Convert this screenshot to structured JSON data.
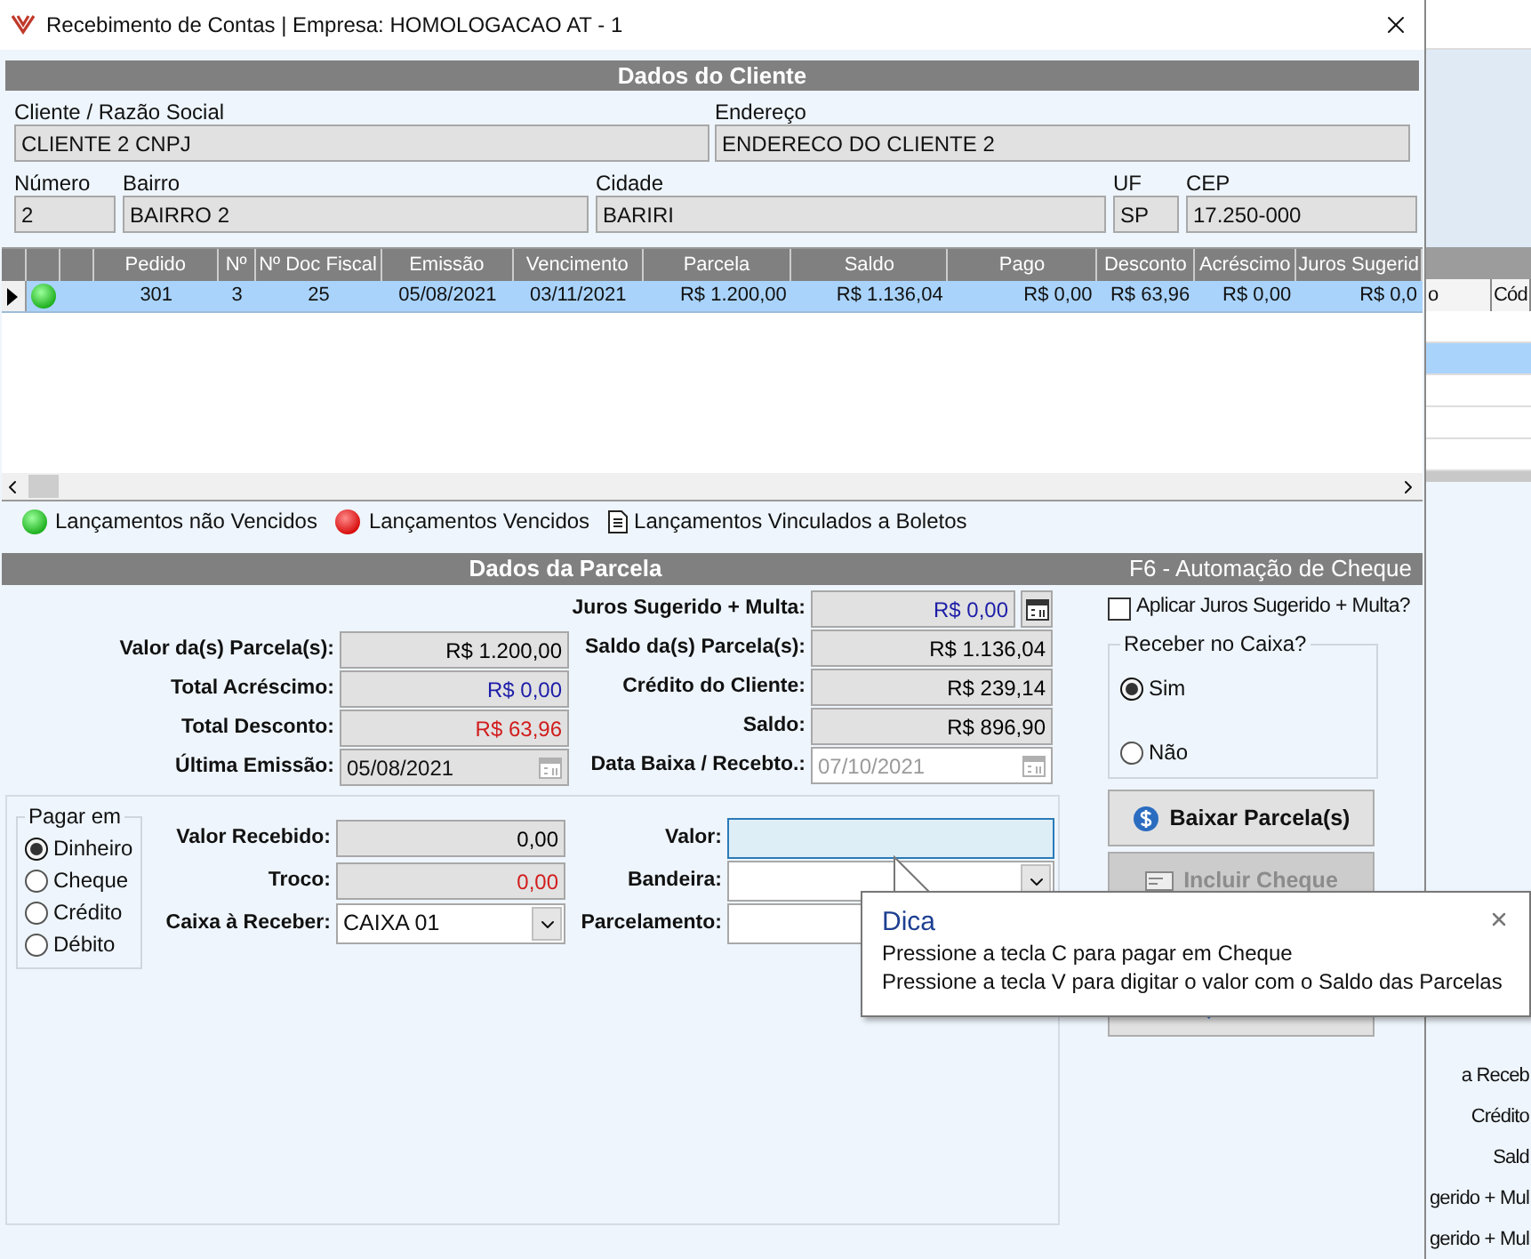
{
  "window": {
    "title": "Recebimento de Contas | Empresa: HOMOLOGACAO AT - 1"
  },
  "client": {
    "header": "Dados do Cliente",
    "row1": [
      {
        "label": "Cliente / Razão Social",
        "value": "CLIENTE 2 CNPJ"
      },
      {
        "label": "Endereço",
        "value": "ENDERECO DO CLIENTE 2"
      }
    ],
    "row2": [
      {
        "label": "Número",
        "value": "2"
      },
      {
        "label": "Bairro",
        "value": "BAIRRO 2"
      },
      {
        "label": "Cidade",
        "value": "BARIRI"
      },
      {
        "label": "UF",
        "value": "SP"
      },
      {
        "label": "CEP",
        "value": "17.250-000"
      }
    ]
  },
  "table": {
    "columns": [
      "Pedido",
      "Nº",
      "Nº Doc Fiscal",
      "Emissão",
      "Vencimento",
      "Parcela",
      "Saldo",
      "Pago",
      "Desconto",
      "Acréscimo",
      "Juros Sugerid"
    ],
    "rows": [
      {
        "selected": true,
        "overdue": false,
        "cells": [
          "301",
          "3",
          "25",
          "05/08/2021",
          "03/11/2021",
          "R$ 1.200,00",
          "R$ 1.136,04",
          "R$ 0,00",
          "R$ 63,96",
          "R$ 0,00",
          "R$ 0,0"
        ]
      }
    ]
  },
  "legend": [
    {
      "kind": "green",
      "label": "Lançamentos não Vencidos"
    },
    {
      "kind": "red",
      "label": "Lançamentos Vencidos"
    },
    {
      "kind": "document",
      "label": "Lançamentos Vinculados a Boletos"
    }
  ],
  "parcela": {
    "header": "Dados da Parcela",
    "shortcut": "F6 - Automação de Cheque",
    "left": [
      {
        "label": "Valor da(s) Parcela(s):",
        "value": "R$ 1.200,00",
        "kind": "money",
        "color": "#000000"
      },
      {
        "label": "Total Acréscimo:",
        "value": "R$ 0,00",
        "kind": "money",
        "color": "#1c1ca8"
      },
      {
        "label": "Total Desconto:",
        "value": "R$ 63,96",
        "kind": "money",
        "color": "#d21c1c"
      },
      {
        "label": "Última Emissão:",
        "value": "05/08/2021",
        "kind": "date",
        "disabled": false
      }
    ],
    "right": [
      {
        "label": "Juros Sugerido + Multa:",
        "value": "R$ 0,00",
        "kind": "money_calendar",
        "color": "#1c1ca8"
      },
      {
        "label": "Saldo da(s) Parcela(s):",
        "value": "R$ 1.136,04",
        "kind": "money",
        "color": "#000000"
      },
      {
        "label": "Crédito do Cliente:",
        "value": "R$ 239,14",
        "kind": "money",
        "color": "#000000"
      },
      {
        "label": "Saldo:",
        "value": "R$ 896,90",
        "kind": "money",
        "color": "#000000"
      },
      {
        "label": "Data Baixa / Recebto.:",
        "value": "07/10/2021",
        "kind": "date",
        "disabled": true
      }
    ]
  },
  "payment": {
    "title": "Pagar em",
    "options": [
      {
        "label": "Dinheiro",
        "selected": true
      },
      {
        "label": "Cheque",
        "selected": false
      },
      {
        "label": "Crédito",
        "selected": false
      },
      {
        "label": "Débito",
        "selected": false
      }
    ],
    "left": [
      {
        "label": "Valor Recebido:",
        "value": "0,00",
        "kind": "readonly",
        "color": "#000000"
      },
      {
        "label": "Troco:",
        "value": "0,00",
        "kind": "readonly",
        "color": "#d21c1c"
      },
      {
        "label": "Caixa à Receber:",
        "value": "CAIXA 01",
        "kind": "combo"
      }
    ],
    "right": [
      {
        "label": "Valor:",
        "kind": "input",
        "focused": true
      },
      {
        "label": "Bandeira:",
        "kind": "combo",
        "focused": false
      },
      {
        "label": "Parcelamento:",
        "kind": "input",
        "focused": false
      }
    ]
  },
  "options": {
    "apply_interest": {
      "label": "Aplicar Juros Sugerido + Multa?",
      "checked": false
    },
    "receive": {
      "title": "Receber no Caixa?",
      "options": [
        {
          "label": "Sim",
          "selected": true
        },
        {
          "label": "Não",
          "selected": false
        }
      ]
    }
  },
  "buttons": [
    {
      "label": "Baixar Parcela(s)",
      "disabled": false,
      "kind": "dollar"
    },
    {
      "label": "Incluir Cheque",
      "disabled": true,
      "kind": "cheque"
    }
  ],
  "tooltip": {
    "title": "Dica",
    "lines": [
      "Pressione a tecla C para pagar em Cheque",
      "Pressione a tecla V para digitar o valor com o Saldo das Parcelas"
    ]
  },
  "background_window": {
    "columns": [
      "o",
      "Cód"
    ],
    "labels": [
      "a Receb",
      "Crédito",
      "Sald",
      "gerido + Mul",
      "gerido + Mul"
    ]
  }
}
